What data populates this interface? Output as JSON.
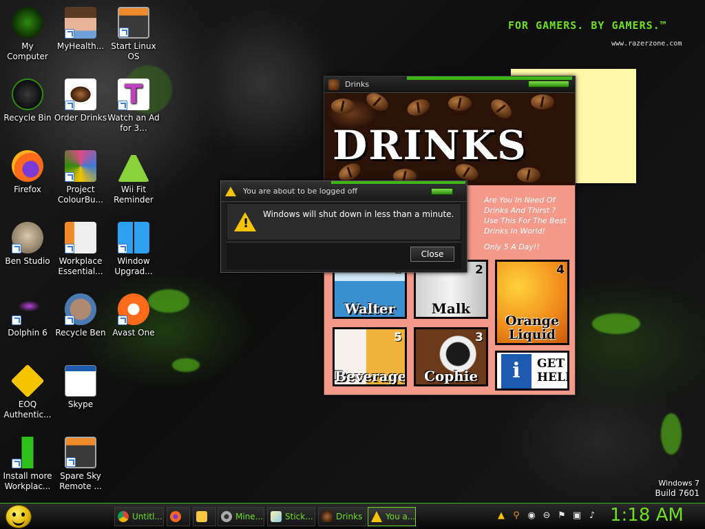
{
  "wallpaper": {
    "slogan": "FOR GAMERS. BY GAMERS.™",
    "site": "www.razerzone.com",
    "accent": "#6ee01f"
  },
  "desktop_icons": [
    {
      "label": "My Computer",
      "icon": "computer-icon"
    },
    {
      "label": "MyHealth...",
      "icon": "avatar-icon"
    },
    {
      "label": "Start Linux OS",
      "icon": "app-window-icon"
    },
    {
      "label": "Recycle Bin",
      "icon": "recycle-bin-icon"
    },
    {
      "label": "Order Drinks",
      "icon": "coffee-bean-icon"
    },
    {
      "label": "Watch an Ad for 3...",
      "icon": "letter-t-icon"
    },
    {
      "label": "Firefox",
      "icon": "firefox-icon"
    },
    {
      "label": "Project ColourBu...",
      "icon": "collage-icon"
    },
    {
      "label": "Wii Fit Reminder",
      "icon": "wii-fit-icon"
    },
    {
      "label": "Ben Studio",
      "icon": "dog-icon"
    },
    {
      "label": "Workplace Essential...",
      "icon": "documents-icon"
    },
    {
      "label": "Window Upgrad...",
      "icon": "windows-logo-icon"
    },
    {
      "label": "Dolphin 6",
      "icon": "dolphin-icon"
    },
    {
      "label": "Recycle Ben",
      "icon": "face-icon"
    },
    {
      "label": "Avast One",
      "icon": "avast-icon"
    },
    {
      "label": "EOQ Authentic...",
      "icon": "key-icon"
    },
    {
      "label": "Skype",
      "icon": "window-icon"
    },
    {
      "label": "Install more Workplac...",
      "icon": "download-arrow-icon"
    },
    {
      "label": "Spare Sky Remote ...",
      "icon": "app-window-icon"
    }
  ],
  "drinks_window": {
    "title": "Drinks",
    "banner": "DRINKS",
    "promo": {
      "line1": "Are You In Need Of Drinks And Thirst ? Use This For The Best Drinks In World!",
      "line2": "Only 5 A Day!!"
    },
    "tiles": [
      {
        "num": "1",
        "name": "Walter"
      },
      {
        "num": "2",
        "name": "Malk"
      },
      {
        "num": "4",
        "name": "Orange Liquid"
      },
      {
        "num": "5",
        "name": "Beverage"
      },
      {
        "num": "3",
        "name": "Cophie"
      }
    ],
    "help": {
      "icon_text": "i",
      "label": "GET HELP"
    }
  },
  "logoff_dialog": {
    "title": "You are about to be logged off",
    "message": "Windows will shut down in less than a minute.",
    "close_label": "Close"
  },
  "winver": {
    "name": "Windows 7",
    "build": "Build 7601"
  },
  "taskbar": {
    "items": [
      {
        "label": "Untitl...",
        "icon": "chrome-icon"
      },
      {
        "label": "",
        "icon": "firefox-icon"
      },
      {
        "label": "",
        "icon": "folder-icon"
      },
      {
        "label": "Mine...",
        "icon": "gear-icon"
      },
      {
        "label": "Stick...",
        "icon": "sticky-notes-icon"
      },
      {
        "label": "Drinks",
        "icon": "coffee-bean-icon"
      },
      {
        "label": "You a...",
        "icon": "warning-icon"
      }
    ],
    "clock": "1:18 AM"
  }
}
